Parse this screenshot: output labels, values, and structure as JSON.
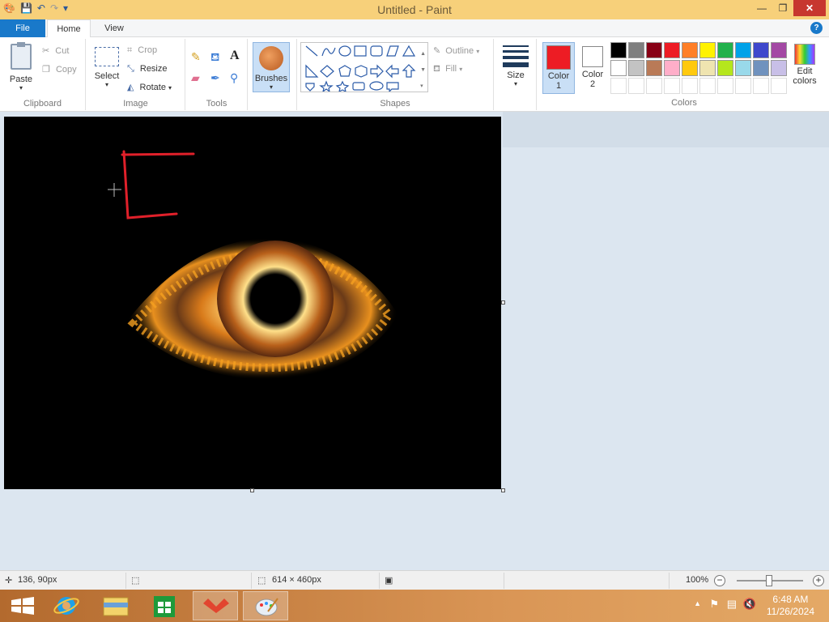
{
  "window": {
    "title": "Untitled - Paint",
    "controls": {
      "minimize": "—",
      "restore": "❐",
      "close": "✕"
    }
  },
  "tabs": [
    {
      "label": "File"
    },
    {
      "label": "Home"
    },
    {
      "label": "View"
    }
  ],
  "help_label": "?",
  "ribbon": {
    "clipboard": {
      "paste": "Paste",
      "cut": "Cut",
      "copy": "Copy",
      "group": "Clipboard"
    },
    "image": {
      "select": "Select",
      "crop": "Crop",
      "resize": "Resize",
      "rotate": "Rotate",
      "group": "Image"
    },
    "tools": {
      "group": "Tools",
      "text_tool": "A"
    },
    "brushes": {
      "label": "Brushes"
    },
    "shapes": {
      "outline": "Outline",
      "fill": "Fill",
      "group": "Shapes"
    },
    "size": {
      "label": "Size"
    },
    "colors": {
      "color1_label": "Color\n1",
      "color1_value": "#ed1c24",
      "color2_label": "Color\n2",
      "color2_value": "#ffffff",
      "edit_colors": "Edit\ncolors",
      "group": "Colors",
      "palette": [
        "#000000",
        "#7f7f7f",
        "#880015",
        "#ed1c24",
        "#ff7f27",
        "#fff200",
        "#22b14c",
        "#00a2e8",
        "#3f48cc",
        "#a349a4",
        "#ffffff",
        "#c3c3c3",
        "#b97a57",
        "#ffaec9",
        "#ffc90e",
        "#efe4b0",
        "#b5e61d",
        "#99d9ea",
        "#7092be",
        "#c8bfe7",
        "",
        "",
        "",
        "",
        "",
        "",
        "",
        "",
        "",
        ""
      ]
    }
  },
  "status": {
    "cursor_position": "136, 90px",
    "image_size": "614 × 460px",
    "zoom": "100%",
    "zoom_level": 100
  },
  "taskbar": {
    "time": "6:48 AM",
    "date": "11/26/2024",
    "apps": [
      "start-button",
      "internet-explorer",
      "file-explorer",
      "store",
      "app-red",
      "paint"
    ]
  }
}
